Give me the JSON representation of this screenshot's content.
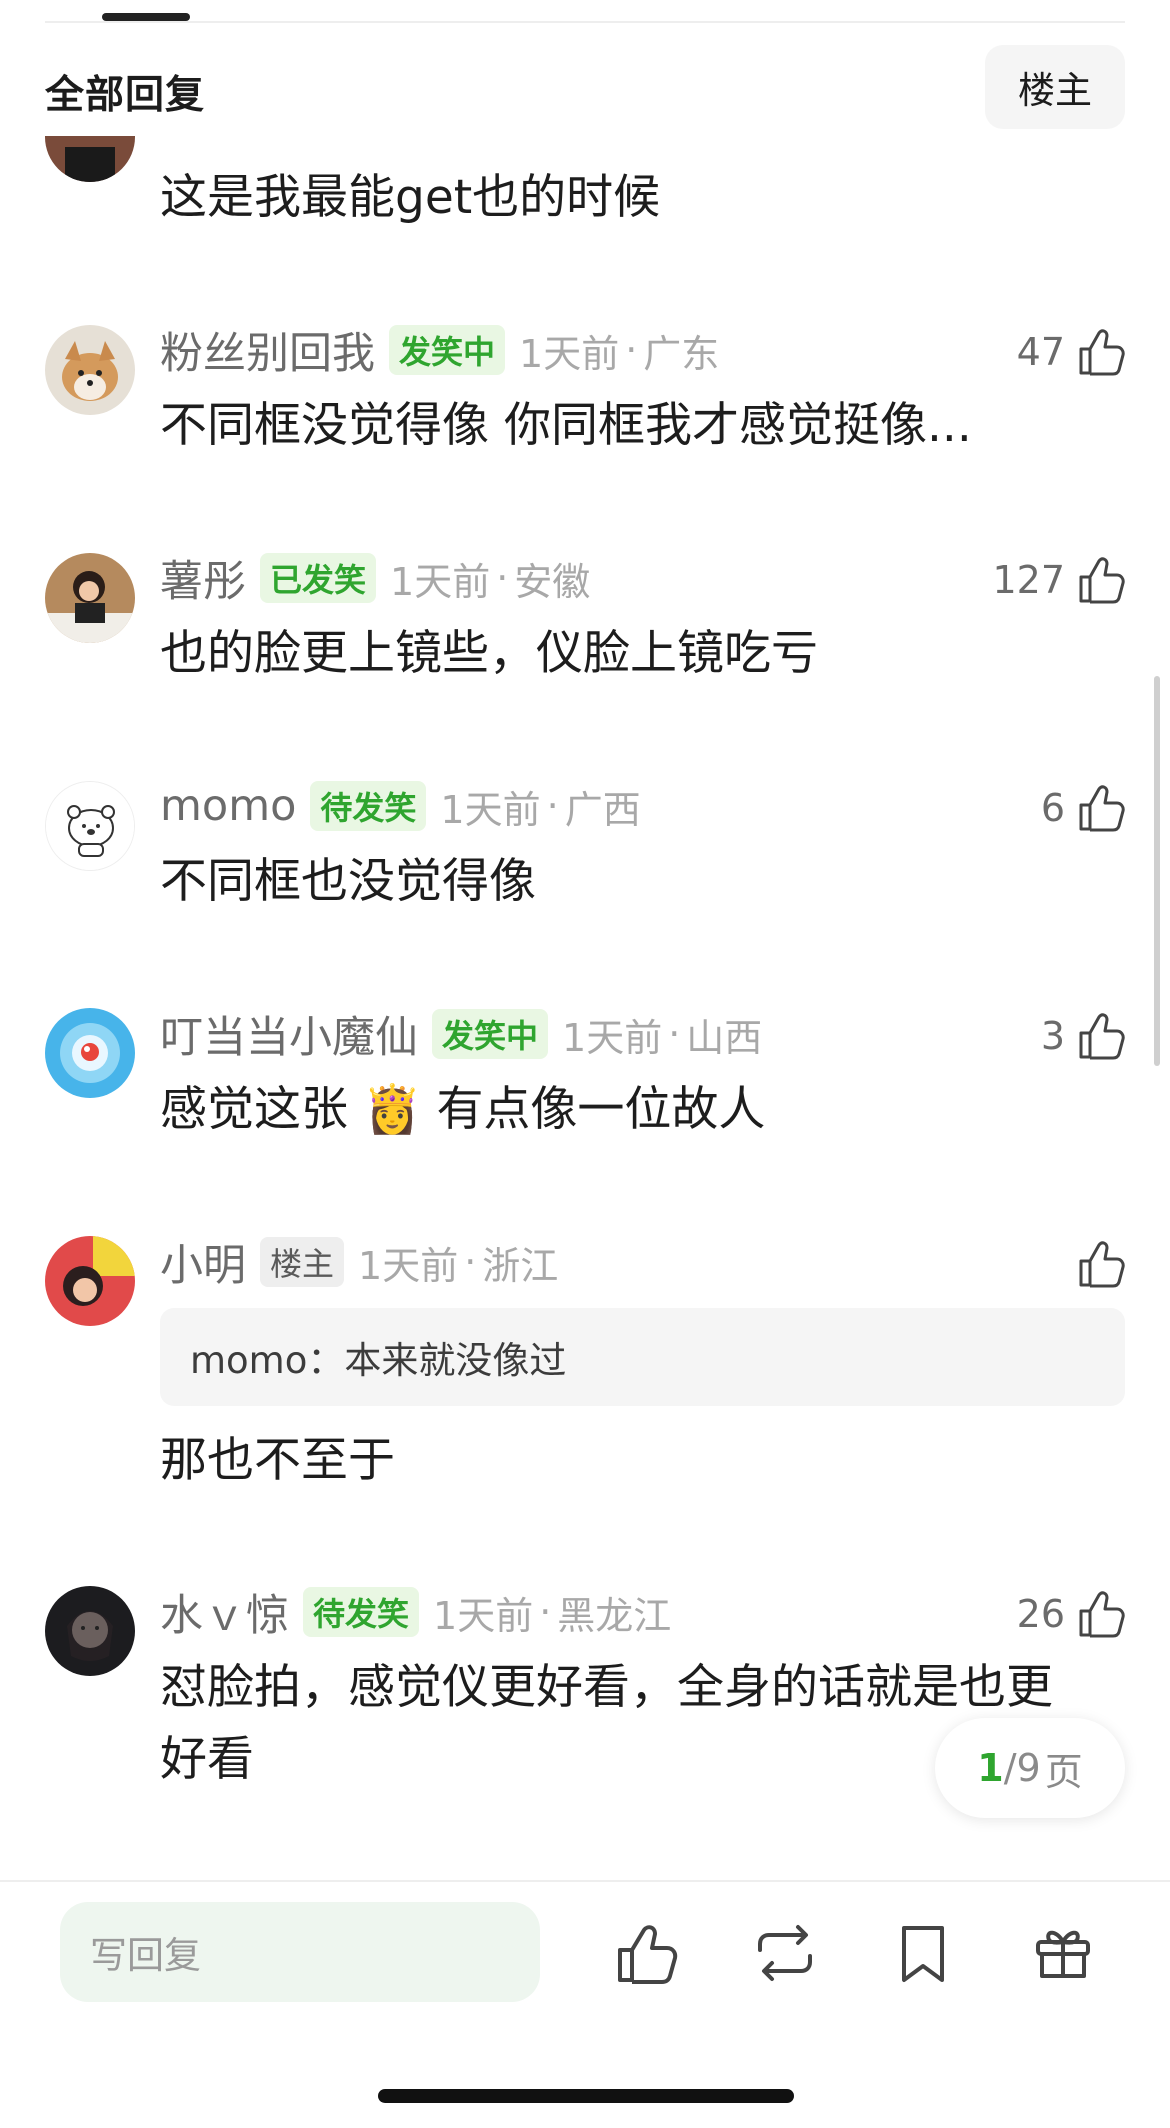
{
  "header": {
    "title": "全部回复",
    "op_button": "楼主"
  },
  "comments": [
    {
      "text": "这是我最能get也的时候"
    },
    {
      "name": "粉丝别回我",
      "badge": "发笑中",
      "time": "1天前",
      "location": "广东",
      "likes": "47",
      "text": "不同框没觉得像 你同框我才感觉挺像..."
    },
    {
      "name": "薯彤",
      "badge": "已发笑",
      "time": "1天前",
      "location": "安徽",
      "likes": "127",
      "text": "也的脸更上镜些，仪脸上镜吃亏"
    },
    {
      "name": "momo",
      "badge": "待发笑",
      "time": "1天前",
      "location": "广西",
      "likes": "6",
      "text": "不同框也没觉得像"
    },
    {
      "name": "叮当当小魔仙",
      "badge": "发笑中",
      "time": "1天前",
      "location": "山西",
      "likes": "3",
      "text_before": "感觉这张",
      "emoji": "👸",
      "text_after": "有点像一位故人"
    },
    {
      "name": "小明",
      "badge": "楼主",
      "time": "1天前",
      "location": "浙江",
      "quote_user": "momo：",
      "quote_text": "本来就没像过",
      "text": "那也不至于"
    },
    {
      "name": "水ｖ惊",
      "badge": "待发笑",
      "time": "1天前",
      "location": "黑龙江",
      "likes": "26",
      "text_line1": "怼脸拍，感觉仪更好看，全身的话就是也更",
      "text_line2": "好看"
    }
  ],
  "pager": {
    "current": "1",
    "total": "/9",
    "unit": "页"
  },
  "bottom_bar": {
    "reply_placeholder": "写回复"
  },
  "icons": [
    "thumbs-up-icon",
    "repost-icon",
    "bookmark-icon",
    "gift-icon"
  ],
  "colors": {
    "accent_green": "#2fa52f",
    "badge_bg": "#e9f7e3",
    "meta_gray": "#a8a8a8"
  }
}
